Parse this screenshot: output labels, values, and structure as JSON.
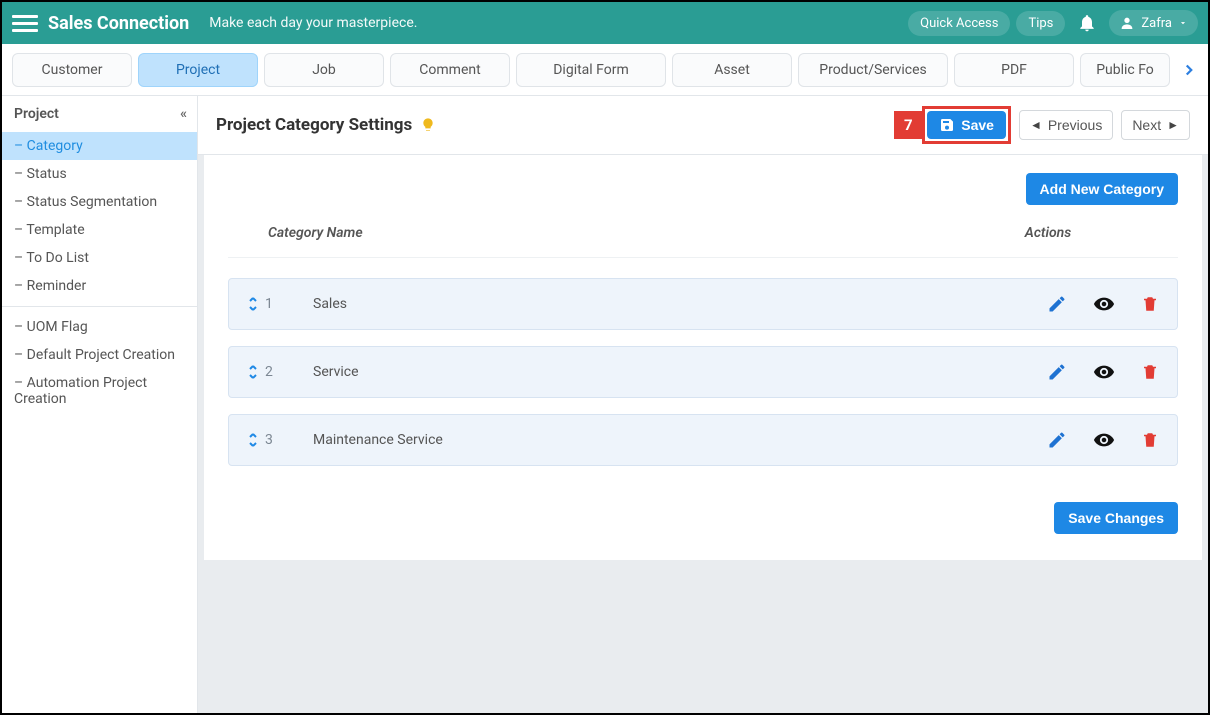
{
  "header": {
    "brand": "Sales Connection",
    "tagline": "Make each day your masterpiece.",
    "quick_access": "Quick Access",
    "tips": "Tips",
    "user_name": "Zafra"
  },
  "tabs": [
    "Customer",
    "Project",
    "Job",
    "Comment",
    "Digital Form",
    "Asset",
    "Product/Services",
    "PDF",
    "Public Fo"
  ],
  "active_tab_index": 1,
  "sidebar": {
    "title": "Project",
    "groups": [
      [
        "Category",
        "Status",
        "Status Segmentation",
        "Template",
        "To Do List",
        "Reminder"
      ],
      [
        "UOM Flag",
        "Default Project Creation",
        "Automation Project Creation"
      ]
    ],
    "active": "Category"
  },
  "page": {
    "title": "Project Category Settings",
    "step_badge": "7",
    "save": "Save",
    "previous": "Previous",
    "next": "Next"
  },
  "content": {
    "add_button": "Add New Category",
    "col_name": "Category Name",
    "col_actions": "Actions",
    "rows": [
      {
        "order": "1",
        "name": "Sales"
      },
      {
        "order": "2",
        "name": "Service"
      },
      {
        "order": "3",
        "name": "Maintenance Service"
      }
    ],
    "save_changes": "Save Changes"
  }
}
